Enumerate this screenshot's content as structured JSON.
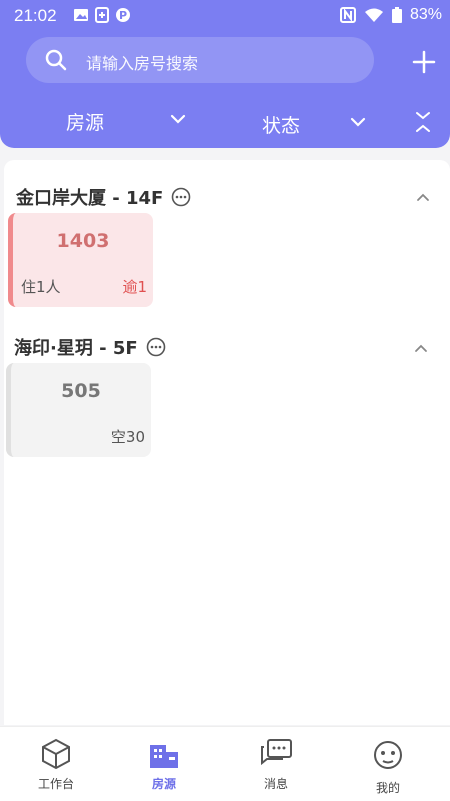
{
  "status_bar": {
    "time": "21:02",
    "battery": "83%"
  },
  "search": {
    "placeholder": "请输入房号搜索"
  },
  "filters": [
    {
      "label": "房源"
    },
    {
      "label": "状态"
    }
  ],
  "groups": [
    {
      "title": "金口岸大厦 - 14F",
      "rooms": [
        {
          "number": "1403",
          "occupancy": "住1人",
          "status_text": "逾1",
          "state": "occupied"
        }
      ]
    },
    {
      "title": "海印·星玥 - 5F",
      "rooms": [
        {
          "number": "505",
          "occupancy": "",
          "status_text": "空30",
          "state": "vacant"
        }
      ]
    }
  ],
  "nav": [
    {
      "label": "工作台",
      "icon": "cube-icon"
    },
    {
      "label": "房源",
      "icon": "building-icon",
      "active": true
    },
    {
      "label": "消息",
      "icon": "chat-icon"
    },
    {
      "label": "我的",
      "icon": "profile-icon"
    }
  ],
  "colors": {
    "accent": "#7b7ef2",
    "occupied_bg": "#fbe6e8",
    "overdue_text": "#e05050"
  }
}
